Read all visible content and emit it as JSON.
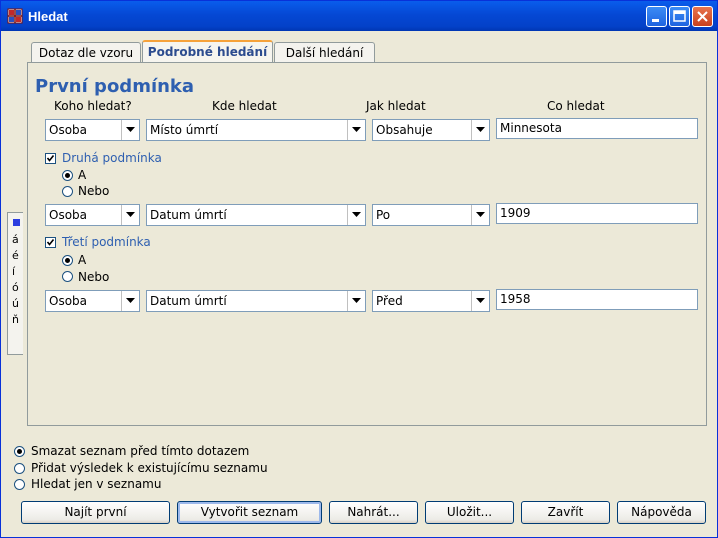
{
  "window": {
    "title": "Hledat"
  },
  "tabs": [
    "Dotaz dle vzoru",
    "Podrobné hledání",
    "Další hledání"
  ],
  "active_tab": 1,
  "heading": "První podmínka",
  "columns": [
    "Koho hledat?",
    "Kde hledat",
    "Jak hledat",
    "Co hledat"
  ],
  "conditions": [
    {
      "who": "Osoba",
      "where": "Místo úmrtí",
      "how": "Obsahuje",
      "what": "Minnesota"
    },
    {
      "label": "Druhá podmínka",
      "checked": true,
      "radio_and": "A",
      "radio_or": "Nebo",
      "selected": "A",
      "who": "Osoba",
      "where": "Datum úmrtí",
      "how": "Po",
      "what": "1909"
    },
    {
      "label": "Třetí podmínka",
      "checked": true,
      "radio_and": "A",
      "radio_or": "Nebo",
      "selected": "A",
      "who": "Osoba",
      "where": "Datum úmrtí",
      "how": "Před",
      "what": "1958"
    }
  ],
  "side_tab": {
    "chars": [
      "á",
      "é",
      "í",
      "ó",
      "ú",
      "ň"
    ]
  },
  "list_options": [
    {
      "label": "Smazat seznam před tímto dotazem",
      "selected": true
    },
    {
      "label": "Přidat výsledek k existujícímu seznamu",
      "selected": false
    },
    {
      "label": "Hledat jen v seznamu",
      "selected": false
    }
  ],
  "buttons": {
    "find_first": "Najít první",
    "create_list": "Vytvořit seznam",
    "load": "Nahrát...",
    "save": "Uložit...",
    "close": "Zavřít",
    "help": "Nápověda"
  },
  "colors": {
    "titlebar": "#0548D4",
    "heading": "#2E5FB0",
    "face": "#ECE9D8"
  }
}
